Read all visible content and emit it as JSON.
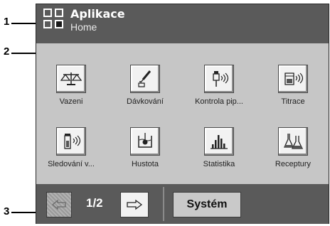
{
  "annotations": [
    "1",
    "2",
    "3"
  ],
  "header": {
    "title": "Aplikace",
    "subtitle": "Home"
  },
  "apps": [
    {
      "label": "Vazeni",
      "icon": "balance-icon"
    },
    {
      "label": "Dávkování",
      "icon": "pipette-dosing-icon"
    },
    {
      "label": "Kontrola pip...",
      "icon": "pipette-check-icon"
    },
    {
      "label": "Titrace",
      "icon": "titration-icon"
    },
    {
      "label": "Sledování v...",
      "icon": "tracking-icon"
    },
    {
      "label": "Hustota",
      "icon": "density-icon"
    },
    {
      "label": "Statistika",
      "icon": "statistics-icon"
    },
    {
      "label": "Receptury",
      "icon": "formulation-flasks-icon"
    }
  ],
  "footer": {
    "page_indicator": "1/2",
    "system_label": "Systém",
    "back_icon": "arrow-left-icon",
    "forward_icon": "arrow-right-icon"
  },
  "colors": {
    "header_bg": "#5a5a5a",
    "content_bg": "#c6c6c6",
    "button_bg": "#f2f2f2"
  }
}
